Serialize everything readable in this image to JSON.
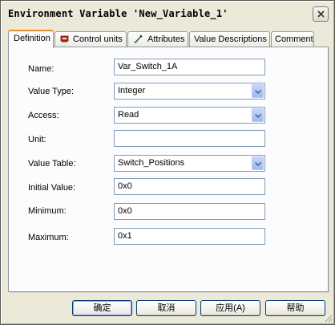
{
  "window": {
    "title": "Environment Variable 'New_Variable_1'"
  },
  "tabs": [
    {
      "label": "Definition",
      "icon": "",
      "active": true
    },
    {
      "label": "Control units",
      "icon": "control-units-icon"
    },
    {
      "label": "Attributes",
      "icon": "attributes-icon"
    },
    {
      "label": "Value Descriptions",
      "icon": ""
    },
    {
      "label": "Comment",
      "icon": ""
    }
  ],
  "form": {
    "name": {
      "label": "Name:",
      "value": "Var_Switch_1A"
    },
    "value_type": {
      "label": "Value Type:",
      "value": "Integer"
    },
    "access": {
      "label": "Access:",
      "value": "Read"
    },
    "unit": {
      "label": "Unit:",
      "value": ""
    },
    "value_table": {
      "label": "Value Table:",
      "value": "Switch_Positions"
    },
    "initial_value": {
      "label": "Initial Value:",
      "value": "0x0"
    },
    "minimum": {
      "label": "Minimum:",
      "value": "0x0"
    },
    "maximum": {
      "label": "Maximum:",
      "value": "0x1"
    }
  },
  "buttons": {
    "ok": "确定",
    "cancel": "取消",
    "apply": "应用(A)",
    "help": "帮助"
  },
  "colors": {
    "window_bg": "#ece9d8",
    "tab_highlight": "#e68b2c",
    "field_border": "#7f9db9"
  }
}
